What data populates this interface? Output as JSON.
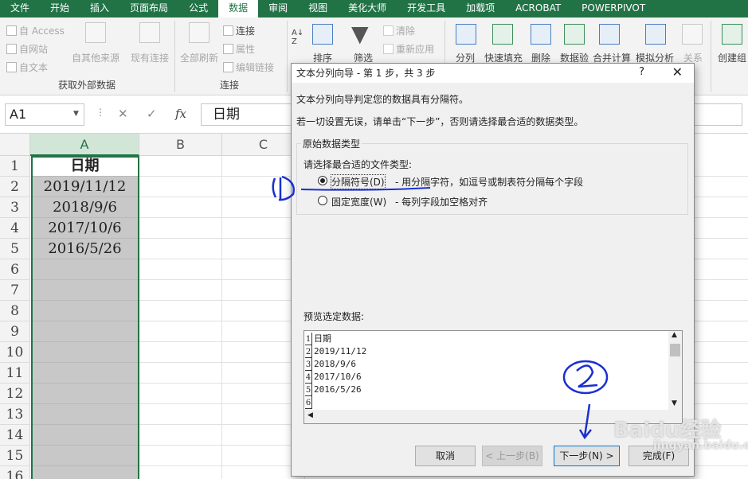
{
  "tabs": [
    "文件",
    "开始",
    "插入",
    "页面布局",
    "公式",
    "数据",
    "审阅",
    "视图",
    "美化大师",
    "开发工具",
    "加载项",
    "ACROBAT",
    "POWERPIVOT"
  ],
  "active_tab": "数据",
  "ribbon": {
    "access": "自 Access",
    "web": "自网站",
    "text": "自文本",
    "other": "自其他来源",
    "existing": "现有连接",
    "group_external": "获取外部数据",
    "refresh": "全部刷新",
    "conn": "连接",
    "props": "属性",
    "editlinks": "编辑链接",
    "group_conn": "连接",
    "sort": "排序",
    "filter": "筛选",
    "clear": "清除",
    "reapply": "重新应用",
    "split": "分列",
    "flashfill": "快速填充",
    "remove": "删除",
    "validate": "数据验",
    "consolidate": "合并计算",
    "whatif": "模拟分析",
    "relation": "关系",
    "group": "创建组"
  },
  "namebox": "A1",
  "formula": "日期",
  "columns": [
    "A",
    "B",
    "C"
  ],
  "rows": [
    "1",
    "2",
    "3",
    "4",
    "5",
    "6",
    "7",
    "8",
    "9",
    "10",
    "11",
    "12",
    "13",
    "14",
    "15",
    "16"
  ],
  "cells": [
    "日期",
    "2019/11/12",
    "2018/9/6",
    "2017/10/6",
    "2016/5/26"
  ],
  "dialog": {
    "title": "文本分列向导 - 第 1 步，共 3 步",
    "help": "?",
    "close": "✕",
    "line1": "文本分列向导判定您的数据具有分隔符。",
    "line2": "若一切设置无误，请单击“下一步”，否则请选择最合适的数据类型。",
    "group_title": "原始数据类型",
    "choose": "请选择最合适的文件类型:",
    "opt1": "分隔符号(D)",
    "opt1_desc": "- 用分隔字符，如逗号或制表符分隔每个字段",
    "opt2": "固定宽度(W)",
    "opt2_desc": "- 每列字段加空格对齐",
    "preview_label": "预览选定数据:",
    "preview_nums": [
      "1",
      "2",
      "3",
      "4",
      "5",
      "6"
    ],
    "preview_lines": [
      "日期",
      "2019/11/12",
      "2018/9/6",
      "2017/10/6",
      "2016/5/26",
      ""
    ],
    "buttons": {
      "cancel": "取消",
      "back": "< 上一步(B)",
      "next": "下一步(N) >",
      "finish": "完成(F)"
    }
  },
  "annotations": {
    "mark1": "1",
    "mark2": "2"
  },
  "watermark": "Baidu经验",
  "watermark_sub": "jingyan.baidu.com"
}
